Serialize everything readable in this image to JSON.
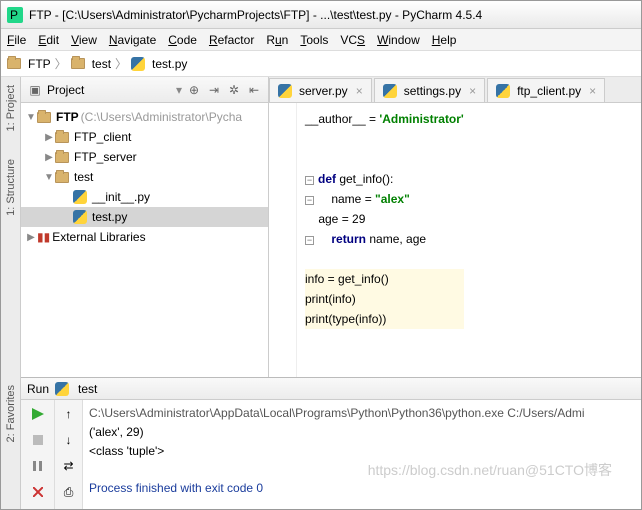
{
  "window": {
    "title": "FTP - [C:\\Users\\Administrator\\PycharmProjects\\FTP] - ...\\test\\test.py - PyCharm 4.5.4"
  },
  "menu": {
    "file": "File",
    "edit": "Edit",
    "view": "View",
    "navigate": "Navigate",
    "code": "Code",
    "refactor": "Refactor",
    "run": "Run",
    "tools": "Tools",
    "vcs": "VCS",
    "window": "Window",
    "help": "Help"
  },
  "breadcrumb": {
    "p0": "FTP",
    "p1": "test",
    "p2": "test.py"
  },
  "sidetabs": {
    "project": "1: Project",
    "structure": "1: Structure",
    "favorites": "2: Favorites"
  },
  "project": {
    "header": "Project",
    "root": "FTP",
    "root_path": "(C:\\Users\\Administrator\\Pycha",
    "ftp_client": "FTP_client",
    "ftp_server": "FTP_server",
    "test": "test",
    "init": "__init__.py",
    "testpy": "test.py",
    "ext": "External Libraries"
  },
  "tabs": {
    "t0": "server.py",
    "t1": "settings.py",
    "t2": "ftp_client.py"
  },
  "code": {
    "l1a": "__author__ = ",
    "l1b": "'Administrator'",
    "l2a": "def",
    "l2b": " get_info():",
    "l3a": "    name = ",
    "l3b": "\"alex\"",
    "l4": "    age = 29",
    "l5a": "    ",
    "l5b": "return",
    "l5c": " name, age",
    "l6": "info = get_info()",
    "l7": "print(info)",
    "l8": "print(type(info))"
  },
  "run": {
    "label": "Run",
    "config": "test",
    "line1": "C:\\Users\\Administrator\\AppData\\Local\\Programs\\Python\\Python36\\python.exe C:/Users/Admi",
    "line2": "('alex', 29)",
    "line3": "<class 'tuple'>",
    "line4": "Process finished with exit code 0"
  },
  "watermark": "https://blog.csdn.net/ruan@51CTO博客"
}
